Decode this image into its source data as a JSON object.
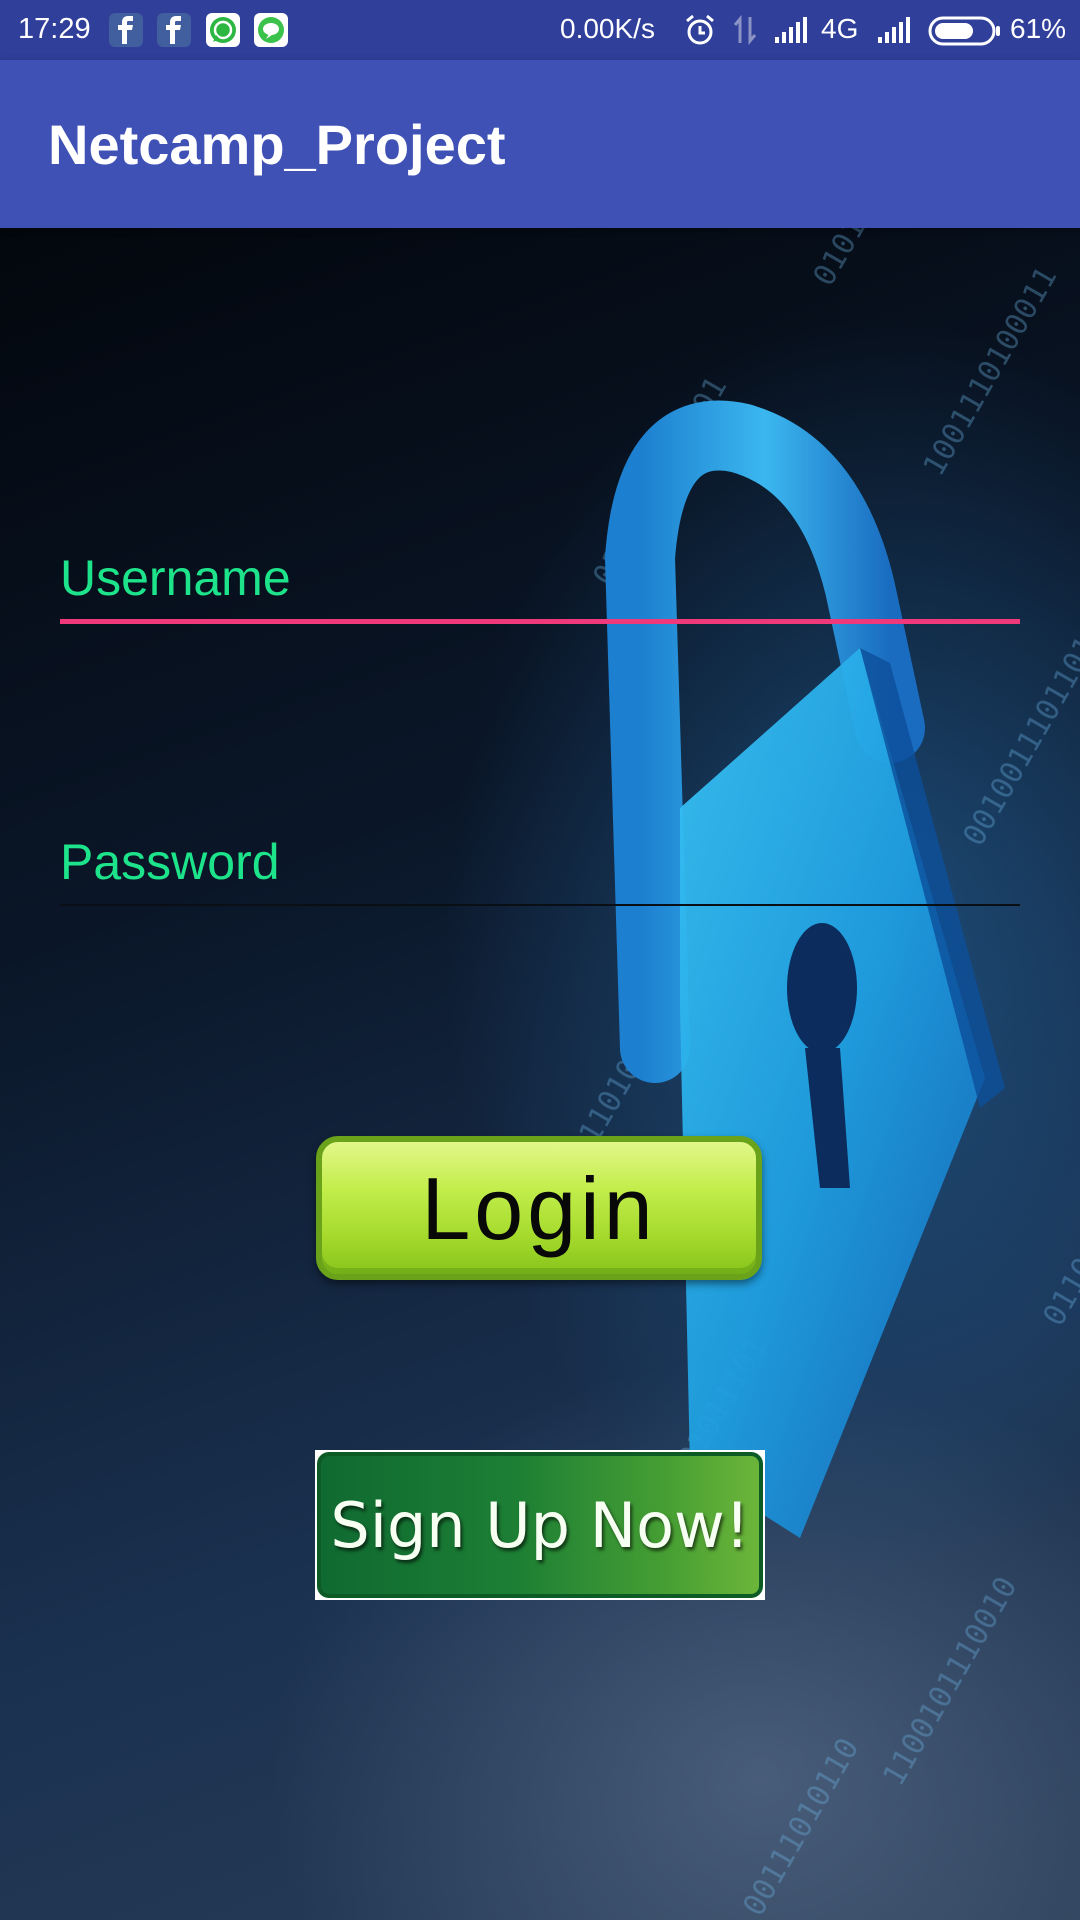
{
  "status_bar": {
    "time": "17:29",
    "notification_icons": [
      "facebook-icon",
      "facebook-icon",
      "whatsapp-icon",
      "line-icon"
    ],
    "network_speed": "0.00K/s",
    "network_type": "4G",
    "battery_level": "61%"
  },
  "app_bar": {
    "title": "Netcamp_Project",
    "color": "#3f51b5"
  },
  "form": {
    "username": {
      "placeholder": "Username",
      "underline_color": "#f0397a",
      "focused": true
    },
    "password": {
      "placeholder": "Password",
      "focused": false
    },
    "hint_color": "#1de38a"
  },
  "buttons": {
    "login_label": "Login",
    "signup_label": "Sign Up Now!"
  },
  "background": {
    "theme": "padlock-binary-security",
    "icon": "padlock-icon"
  }
}
